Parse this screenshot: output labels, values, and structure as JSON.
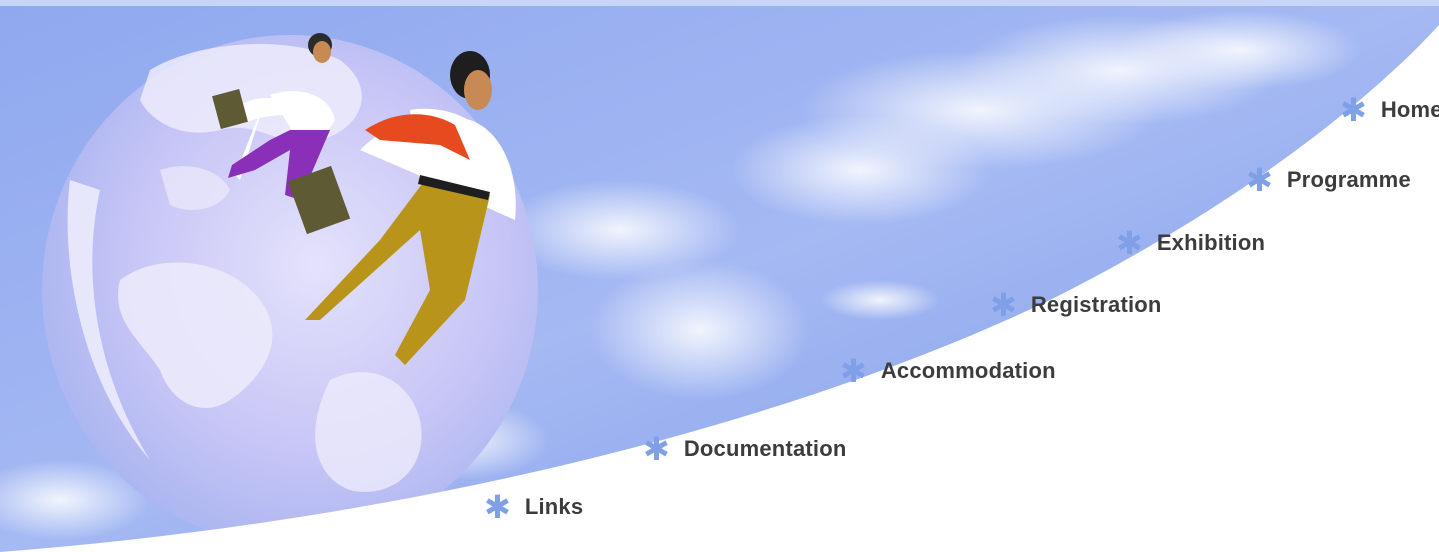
{
  "nav": {
    "items": [
      {
        "id": "home",
        "label": "Home"
      },
      {
        "id": "programme",
        "label": "Programme"
      },
      {
        "id": "exhibition",
        "label": "Exhibition"
      },
      {
        "id": "registration",
        "label": "Registration"
      },
      {
        "id": "accommodation",
        "label": "Accommodation"
      },
      {
        "id": "documentation",
        "label": "Documentation"
      },
      {
        "id": "links",
        "label": "Links"
      }
    ]
  },
  "theme": {
    "sky_top": "#9ab3f2",
    "sky_bottom": "#7c9be8",
    "bullet_color": "#7f9fe6",
    "label_color": "#3c3c3c",
    "tie_color": "#e84a20",
    "trousers_color": "#b8941a",
    "woman_trousers_color": "#8a2fb8",
    "briefcase_color": "#5e5a34"
  },
  "icons": {
    "nav_bullet": "asterisk-bullet-icon"
  }
}
